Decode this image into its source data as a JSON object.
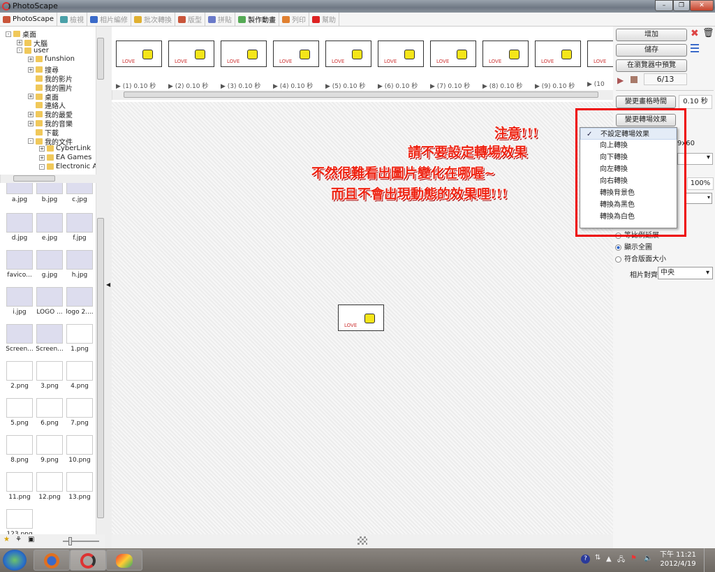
{
  "window": {
    "title": "PhotoScape"
  },
  "toolbar": {
    "tabs": [
      {
        "label": "PhotoScape",
        "color": "#c9553a"
      },
      {
        "label": "檢視",
        "color": "#4aa0a8"
      },
      {
        "label": "相片編修",
        "color": "#3a6ac9"
      },
      {
        "label": "批次轉換",
        "color": "#e0b030"
      },
      {
        "label": "版型",
        "color": "#c9553a"
      },
      {
        "label": "拼貼",
        "color": "#6a7ac9"
      },
      {
        "label": "製作動畫",
        "color": "#55aa55"
      },
      {
        "label": "列印",
        "color": "#e08030"
      },
      {
        "label": "幫助",
        "color": "#d22"
      }
    ],
    "active": "製作動畫"
  },
  "tree": [
    {
      "label": "桌面",
      "level": 0,
      "pm": "-"
    },
    {
      "label": "大腦",
      "level": 1,
      "pm": "+"
    },
    {
      "label": "user",
      "level": 1,
      "pm": "-"
    },
    {
      "label": "funshion",
      "level": 2,
      "pm": "+"
    },
    {
      "label": "搜尋",
      "level": 2,
      "pm": "+"
    },
    {
      "label": "我的影片",
      "level": 2,
      "pm": ""
    },
    {
      "label": "我的圖片",
      "level": 2,
      "pm": ""
    },
    {
      "label": "桌面",
      "level": 2,
      "pm": "+"
    },
    {
      "label": "連絡人",
      "level": 2,
      "pm": ""
    },
    {
      "label": "我的最愛",
      "level": 2,
      "pm": "+"
    },
    {
      "label": "我的音樂",
      "level": 2,
      "pm": "+"
    },
    {
      "label": "下載",
      "level": 2,
      "pm": ""
    },
    {
      "label": "我的文件",
      "level": 2,
      "pm": "-"
    },
    {
      "label": "CyberLink",
      "level": 3,
      "pm": "+"
    },
    {
      "label": "EA Games",
      "level": 3,
      "pm": "+"
    },
    {
      "label": "Electronic A",
      "level": 3,
      "pm": "-"
    }
  ],
  "files": [
    "a.jpg",
    "b.jpg",
    "c.jpg",
    "d.jpg",
    "e.jpg",
    "f.jpg",
    "favico...",
    "g.jpg",
    "h.jpg",
    "i.jpg",
    "LOGO ...",
    "logo 2....",
    "Screen...",
    "Screen...",
    "1.png",
    "2.png",
    "3.png",
    "4.png",
    "5.png",
    "6.png",
    "7.png",
    "8.png",
    "9.png",
    "10.png",
    "11.png",
    "12.png",
    "13.png",
    "123.png"
  ],
  "frames": [
    "(1) 0.10 秒",
    "(2) 0.10 秒",
    "(3) 0.10 秒",
    "(4) 0.10 秒",
    "(5) 0.10 秒",
    "(6) 0.10 秒",
    "(7) 0.10 秒",
    "(8) 0.10 秒",
    "(9) 0.10 秒",
    "(10"
  ],
  "frame_art": {
    "love": "LOVE"
  },
  "right": {
    "add": "增加",
    "save": "儲存",
    "preview": "在瀏覽器中預覽",
    "counter": "6/13",
    "change_time": "變更畫格時間",
    "time_value": "0.10 秒",
    "change_transition": "變更轉場效果",
    "size_partial": "9x60",
    "percent": "100%",
    "ratio_partial": "等比例延展",
    "show_all": "顯示全圖",
    "fit_page": "符合版面大小",
    "align_label": "相片對齊",
    "align_value": "中央"
  },
  "menu": {
    "items": [
      "不設定轉場效果",
      "向上轉換",
      "向下轉換",
      "向左轉換",
      "向右轉換",
      "轉換背景色",
      "轉換為黑色",
      "轉換為白色"
    ],
    "checked": 0
  },
  "annotation": {
    "lines": [
      "注意!!!",
      "請不要設定轉場效果",
      "不然很難看出圖片變化在哪喔~",
      "而且不會出現動態的效果哩!!!"
    ],
    "color": "#e21"
  },
  "taskbar": {
    "time": "下午 11:21",
    "date": "2012/4/19"
  }
}
